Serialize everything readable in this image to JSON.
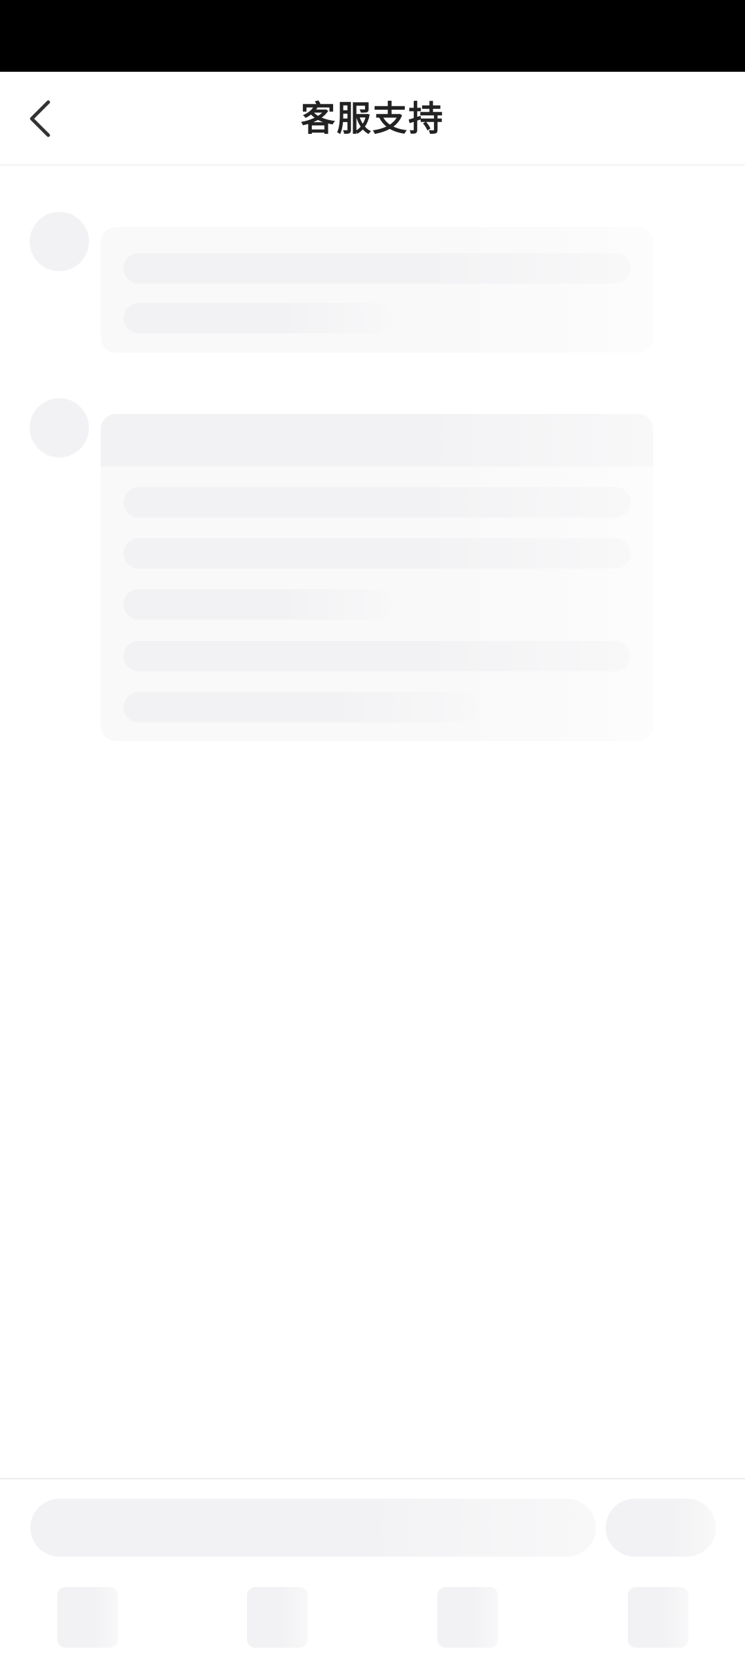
{
  "header": {
    "title": "客服支持",
    "back_icon": "chevron-left-icon"
  },
  "theme": {
    "status_bar_color": "#000000",
    "skeleton_color": "#f2f2f4",
    "card_color": "#f9f9f9",
    "title_color": "#222222"
  },
  "skeleton": {
    "loading": true,
    "message_count": 2,
    "toolbar_slots": 4
  }
}
